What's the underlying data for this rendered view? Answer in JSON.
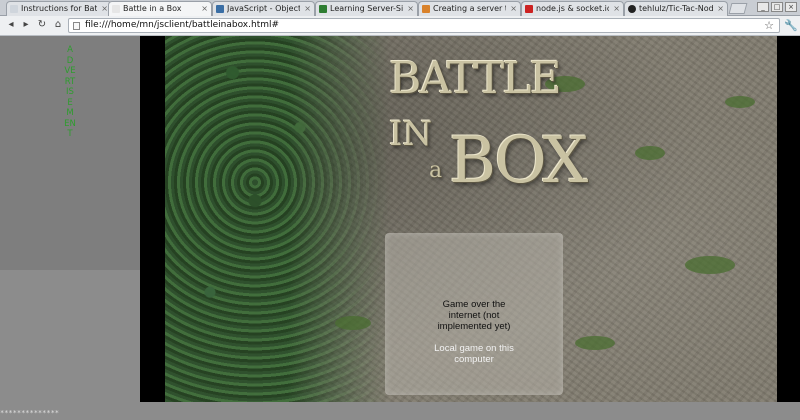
{
  "browser": {
    "tabs": [
      {
        "label": "Instructions for Batt",
        "favicon_color": "#cfd5dc"
      },
      {
        "label": "Battle in a Box",
        "favicon_color": "#e6e6e6"
      },
      {
        "label": "JavaScript - Objects",
        "favicon_color": "#3a6ea5"
      },
      {
        "label": "Learning Server-Side",
        "favicon_color": "#2e7d32"
      },
      {
        "label": "Creating a server to",
        "favicon_color": "#d9822b"
      },
      {
        "label": "node.js & socket.io T",
        "favicon_color": "#cc2222"
      },
      {
        "label": "tehlulz/Tic-Tac-Node",
        "favicon_color": "#222222"
      }
    ],
    "tab_close_glyph": "×",
    "url": "file:///home/mn/jsclient/battleinabox.html#",
    "nav": {
      "back": "◂",
      "forward": "▸",
      "reload": "↻",
      "home": "⌂"
    },
    "star_glyph": "☆",
    "wrench_glyph": "🔧"
  },
  "page": {
    "advertisement_label": "ADVERTISEMENT",
    "title": {
      "battle": "BATTLE",
      "in": "IN",
      "a": "a",
      "box": "BOX"
    },
    "menu": {
      "online_option": "Game over the internet (not implemented yet)",
      "local_option": "Local game on this computer"
    },
    "status_dots": "**************"
  },
  "colors": {
    "ad_text": "#2e9d2e",
    "sidebar": "#7e7e7e",
    "frame": "#000000"
  }
}
